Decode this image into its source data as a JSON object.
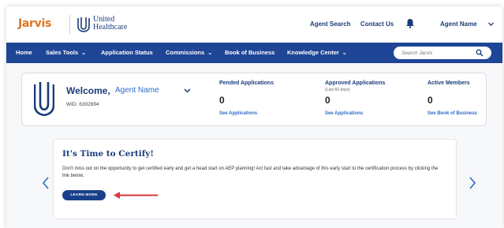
{
  "header": {
    "logo_text": "Jarvis",
    "brand_line1": "United",
    "brand_line2": "Healthcare",
    "links": [
      "Agent Search",
      "Contact Us"
    ],
    "agent_name": "Agent Name",
    "icons": [
      "bell-icon",
      "chevron-down-icon"
    ]
  },
  "nav": {
    "items": [
      {
        "label": "Home",
        "has_dropdown": false
      },
      {
        "label": "Sales Tools",
        "has_dropdown": true
      },
      {
        "label": "Application Status",
        "has_dropdown": false
      },
      {
        "label": "Commissions",
        "has_dropdown": true
      },
      {
        "label": "Book of Business",
        "has_dropdown": false
      },
      {
        "label": "Knowledge Center",
        "has_dropdown": true
      }
    ],
    "search_placeholder": "Search Jarvis"
  },
  "welcome": {
    "title": "Welcome,",
    "agent_name": "Agent Name",
    "wid": "WID: 6392894"
  },
  "stats": [
    {
      "label": "Pended Applications",
      "sub": "",
      "value": "0",
      "link": "See Applications"
    },
    {
      "label": "Approved Applications",
      "sub": "(Last 60 days)",
      "value": "0",
      "link": "See Applications"
    },
    {
      "label": "Active Members",
      "sub": "",
      "value": "0",
      "link": "See Book of Business"
    }
  ],
  "certify": {
    "title": "It's Time to Certify!",
    "body": "Don't miss out on the opportunity to get certified early and get a head start on AEP planning! Act fast and take advantage of this early start to the certification process by clicking the link below.",
    "button": "LEARN MORE"
  },
  "colors": {
    "nav_bg": "#1f4596",
    "brand_blue": "#1a3c7a",
    "link_blue": "#2d6bc7",
    "jarvis_orange": "#e0731f",
    "arrow_red": "#d9363e"
  }
}
